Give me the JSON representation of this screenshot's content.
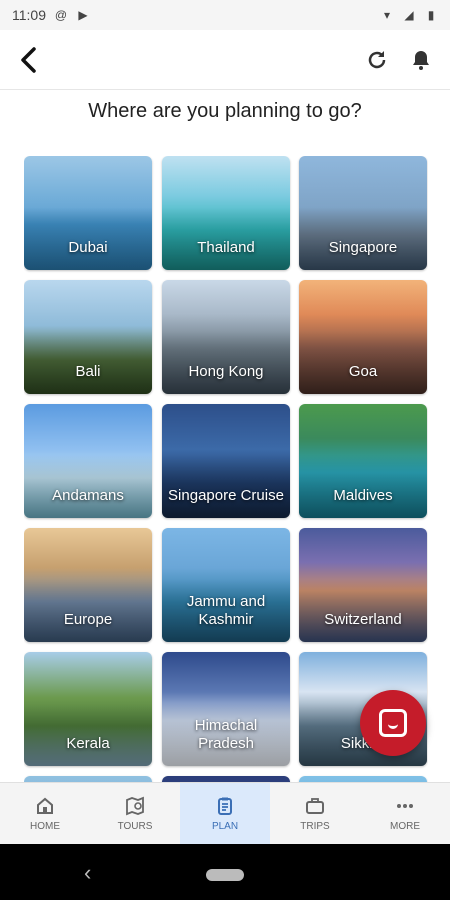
{
  "status_bar": {
    "time": "11:09",
    "icons": [
      "at-sign-icon",
      "play-store-icon",
      "wifi-icon",
      "signal-icon",
      "battery-icon"
    ]
  },
  "app_bar": {
    "icons": [
      "back-arrow-icon",
      "refresh-icon",
      "bell-icon"
    ]
  },
  "page": {
    "title": "Where are you planning to go?"
  },
  "destinations": [
    {
      "label": "Dubai",
      "theme": "sea-sky"
    },
    {
      "label": "Thailand",
      "theme": "turquoise"
    },
    {
      "label": "Singapore",
      "theme": "city-sky"
    },
    {
      "label": "Bali",
      "theme": "temple"
    },
    {
      "label": "Hong Kong",
      "theme": "city"
    },
    {
      "label": "Goa",
      "theme": "sunset-beach"
    },
    {
      "label": "Andamans",
      "theme": "sky-sea"
    },
    {
      "label": "Singapore Cruise",
      "theme": "ocean-night"
    },
    {
      "label": "Maldives",
      "theme": "tropical"
    },
    {
      "label": "Europe",
      "theme": "canal"
    },
    {
      "label": "Jammu and Kashmir",
      "theme": "lake"
    },
    {
      "label": "Switzerland",
      "theme": "alpine"
    },
    {
      "label": "Kerala",
      "theme": "backwater"
    },
    {
      "label": "Himachal Pradesh",
      "theme": "snow"
    },
    {
      "label": "Sikkim",
      "theme": "himalaya"
    }
  ],
  "fab": {
    "icon": "chat-icon",
    "color": "#c51c2a"
  },
  "bottom_nav": {
    "items": [
      {
        "label": "HOME",
        "icon": "home-icon"
      },
      {
        "label": "TOURS",
        "icon": "map-search-icon"
      },
      {
        "label": "PLAN",
        "icon": "clipboard-icon",
        "active": true
      },
      {
        "label": "TRIPS",
        "icon": "briefcase-icon"
      },
      {
        "label": "MORE",
        "icon": "more-dots-icon"
      }
    ],
    "active_color": "#3b6fb5",
    "active_bg": "#dbe9fb"
  },
  "system_nav": {
    "icons": [
      "system-back-icon",
      "home-pill-icon"
    ]
  }
}
